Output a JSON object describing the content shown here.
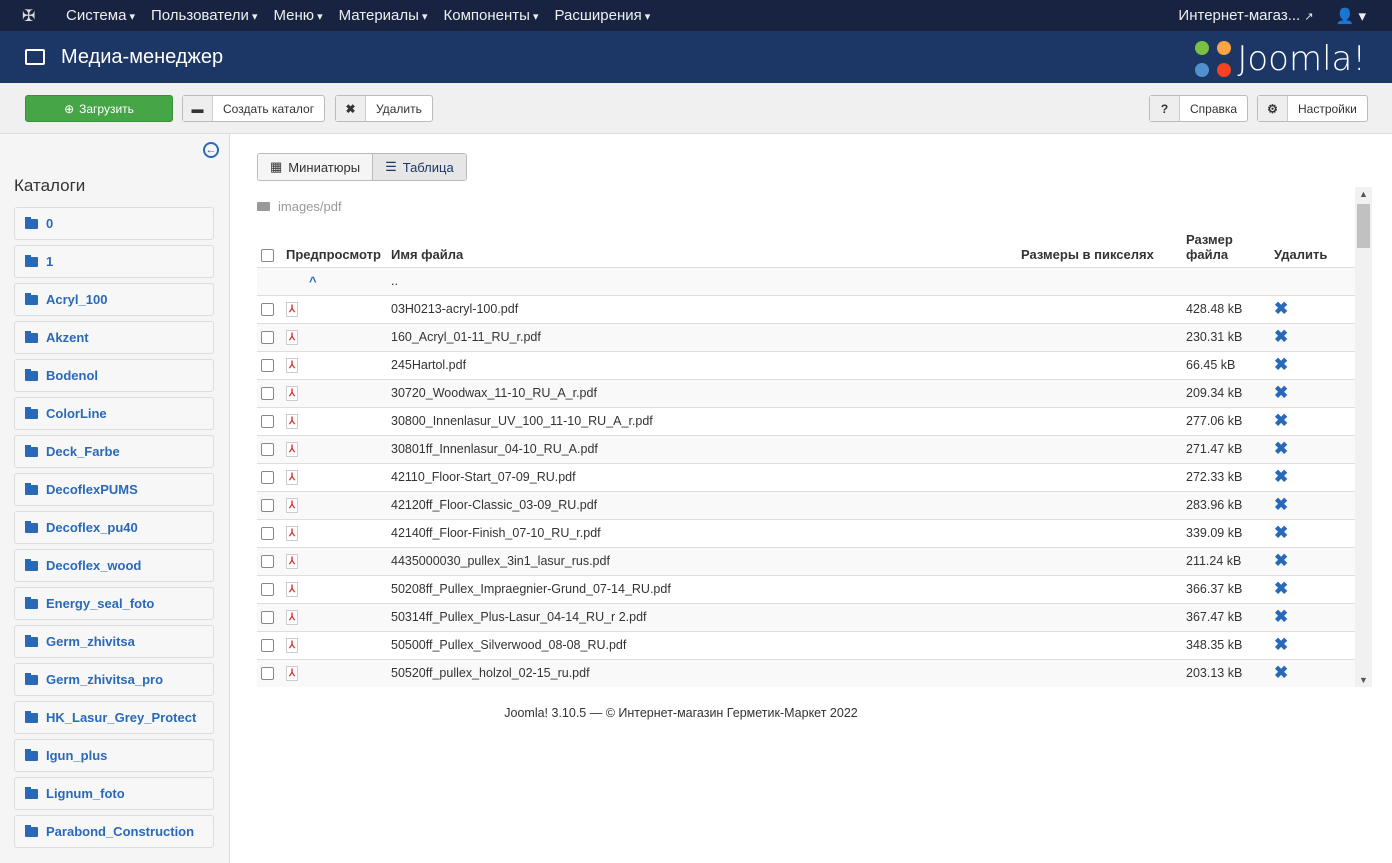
{
  "nav": {
    "menu": [
      "Система",
      "Пользователи",
      "Меню",
      "Материалы",
      "Компоненты",
      "Расширения"
    ],
    "site": "Интернет-магаз...",
    "user_icon": "user-icon"
  },
  "header": {
    "title": "Медиа-менеджер",
    "logo": "Joomla!"
  },
  "toolbar": {
    "upload": "Загрузить",
    "create_folder": "Создать каталог",
    "delete": "Удалить",
    "help": "Справка",
    "options": "Настройки"
  },
  "sidebar": {
    "title": "Каталоги",
    "folders": [
      "0",
      "1",
      "Acryl_100",
      "Akzent",
      "Bodenol",
      "ColorLine",
      "Deck_Farbe",
      "DecoflexPUMS",
      "Decoflex_pu40",
      "Decoflex_wood",
      "Energy_seal_foto",
      "Germ_zhivitsa",
      "Germ_zhivitsa_pro",
      "HK_Lasur_Grey_Protect",
      "Igun_plus",
      "Lignum_foto",
      "Parabond_Construction"
    ]
  },
  "views": {
    "thumbs": "Миниатюры",
    "table": "Таблица"
  },
  "path": "images/pdf",
  "table": {
    "headers": {
      "preview": "Предпросмотр",
      "name": "Имя файла",
      "dims": "Размеры в пикселях",
      "size": "Размер файла",
      "delete": "Удалить"
    },
    "up": "..",
    "rows": [
      [
        "03H0213-acryl-100.pdf",
        "428.48 kB"
      ],
      [
        "160_Acryl_01-11_RU_r.pdf",
        "230.31 kB"
      ],
      [
        "245Hartol.pdf",
        "66.45 kB"
      ],
      [
        "30720_Woodwax_11-10_RU_A_r.pdf",
        "209.34 kB"
      ],
      [
        "30800_Innenlasur_UV_100_11-10_RU_A_r.pdf",
        "277.06 kB"
      ],
      [
        "30801ff_Innenlasur_04-10_RU_A.pdf",
        "271.47 kB"
      ],
      [
        "42110_Floor-Start_07-09_RU.pdf",
        "272.33 kB"
      ],
      [
        "42120ff_Floor-Classic_03-09_RU.pdf",
        "283.96 kB"
      ],
      [
        "42140ff_Floor-Finish_07-10_RU_r.pdf",
        "339.09 kB"
      ],
      [
        "4435000030_pullex_3in1_lasur_rus.pdf",
        "211.24 kB"
      ],
      [
        "50208ff_Pullex_Impraegnier-Grund_07-14_RU.pdf",
        "366.37 kB"
      ],
      [
        "50314ff_Pullex_Plus-Lasur_04-14_RU_r 2.pdf",
        "367.47 kB"
      ],
      [
        "50500ff_Pullex_Silverwood_08-08_RU.pdf",
        "348.35 kB"
      ],
      [
        "50520ff_pullex_holzol_02-15_ru.pdf",
        "203.13 kB"
      ]
    ]
  },
  "footer": "Joomla! 3.10.5  —  © Интернет-магазин Герметик-Маркет 2022"
}
